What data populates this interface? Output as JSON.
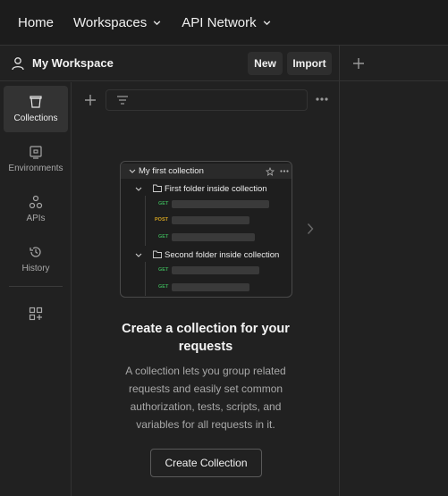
{
  "topbar": {
    "home": "Home",
    "workspaces": "Workspaces",
    "api_network": "API Network"
  },
  "workspace": {
    "title": "My Workspace",
    "new_label": "New",
    "import_label": "Import"
  },
  "sidebar": {
    "items": [
      {
        "label": "Collections",
        "icon": "collections-icon",
        "active": true
      },
      {
        "label": "Environments",
        "icon": "environments-icon"
      },
      {
        "label": "APIs",
        "icon": "apis-icon"
      },
      {
        "label": "History",
        "icon": "history-icon"
      }
    ]
  },
  "preview": {
    "collection": "My first collection",
    "folder1": "First folder inside collection",
    "folder2": "Second folder inside collection",
    "methods": [
      "GET",
      "POST",
      "GET",
      "GET",
      "GET"
    ]
  },
  "empty_state": {
    "title": "Create a collection for your requests",
    "description": "A collection lets you group related requests and easily set common authorization, tests, scripts, and variables for all requests in it.",
    "button": "Create Collection"
  },
  "colors": {
    "get": "#3aa655",
    "post": "#d0a020"
  }
}
